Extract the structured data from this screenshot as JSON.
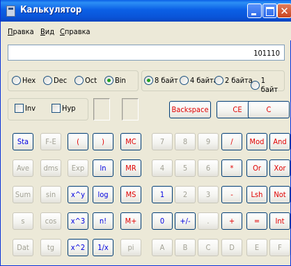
{
  "window": {
    "title": "Калькулятор"
  },
  "menu": [
    {
      "prefix": "",
      "underline": "П",
      "rest": "равка"
    },
    {
      "prefix": "",
      "underline": "В",
      "rest": "ид"
    },
    {
      "prefix": "",
      "underline": "С",
      "rest": "правка"
    }
  ],
  "display": {
    "value": "101110"
  },
  "base_radios": [
    {
      "label": "Hex",
      "selected": false
    },
    {
      "label": "Dec",
      "selected": false
    },
    {
      "label": "Oct",
      "selected": false
    },
    {
      "label": "Bin",
      "selected": true
    }
  ],
  "word_radios": [
    {
      "label": "8 байт",
      "selected": true
    },
    {
      "label": "4 байта",
      "selected": false
    },
    {
      "label": "2 байта",
      "selected": false
    },
    {
      "label": "1 байт",
      "selected": false
    }
  ],
  "checkboxes": [
    {
      "label": "Inv",
      "checked": false
    },
    {
      "label": "Hyp",
      "checked": false
    }
  ],
  "edit_buttons": {
    "backspace": "Backspace",
    "ce": "CE",
    "c": "C"
  },
  "rows": [
    [
      "Sta",
      "F-E",
      "(",
      ")",
      "MC",
      "7",
      "8",
      "9",
      "/",
      "Mod",
      "And"
    ],
    [
      "Ave",
      "dms",
      "Exp",
      "ln",
      "MR",
      "4",
      "5",
      "6",
      "*",
      "Or",
      "Xor"
    ],
    [
      "Sum",
      "sin",
      "x^y",
      "log",
      "MS",
      "1",
      "2",
      "3",
      "-",
      "Lsh",
      "Not"
    ],
    [
      "s",
      "cos",
      "x^3",
      "n!",
      "M+",
      "0",
      "+/-",
      ".",
      "+",
      "=",
      "Int"
    ],
    [
      "Dat",
      "tg",
      "x^2",
      "1/x",
      "pi",
      "A",
      "B",
      "C",
      "D",
      "E",
      "F"
    ]
  ],
  "colors": {
    "red": "#e00000",
    "blue": "#0000e0",
    "disabled": "#a3a296"
  }
}
